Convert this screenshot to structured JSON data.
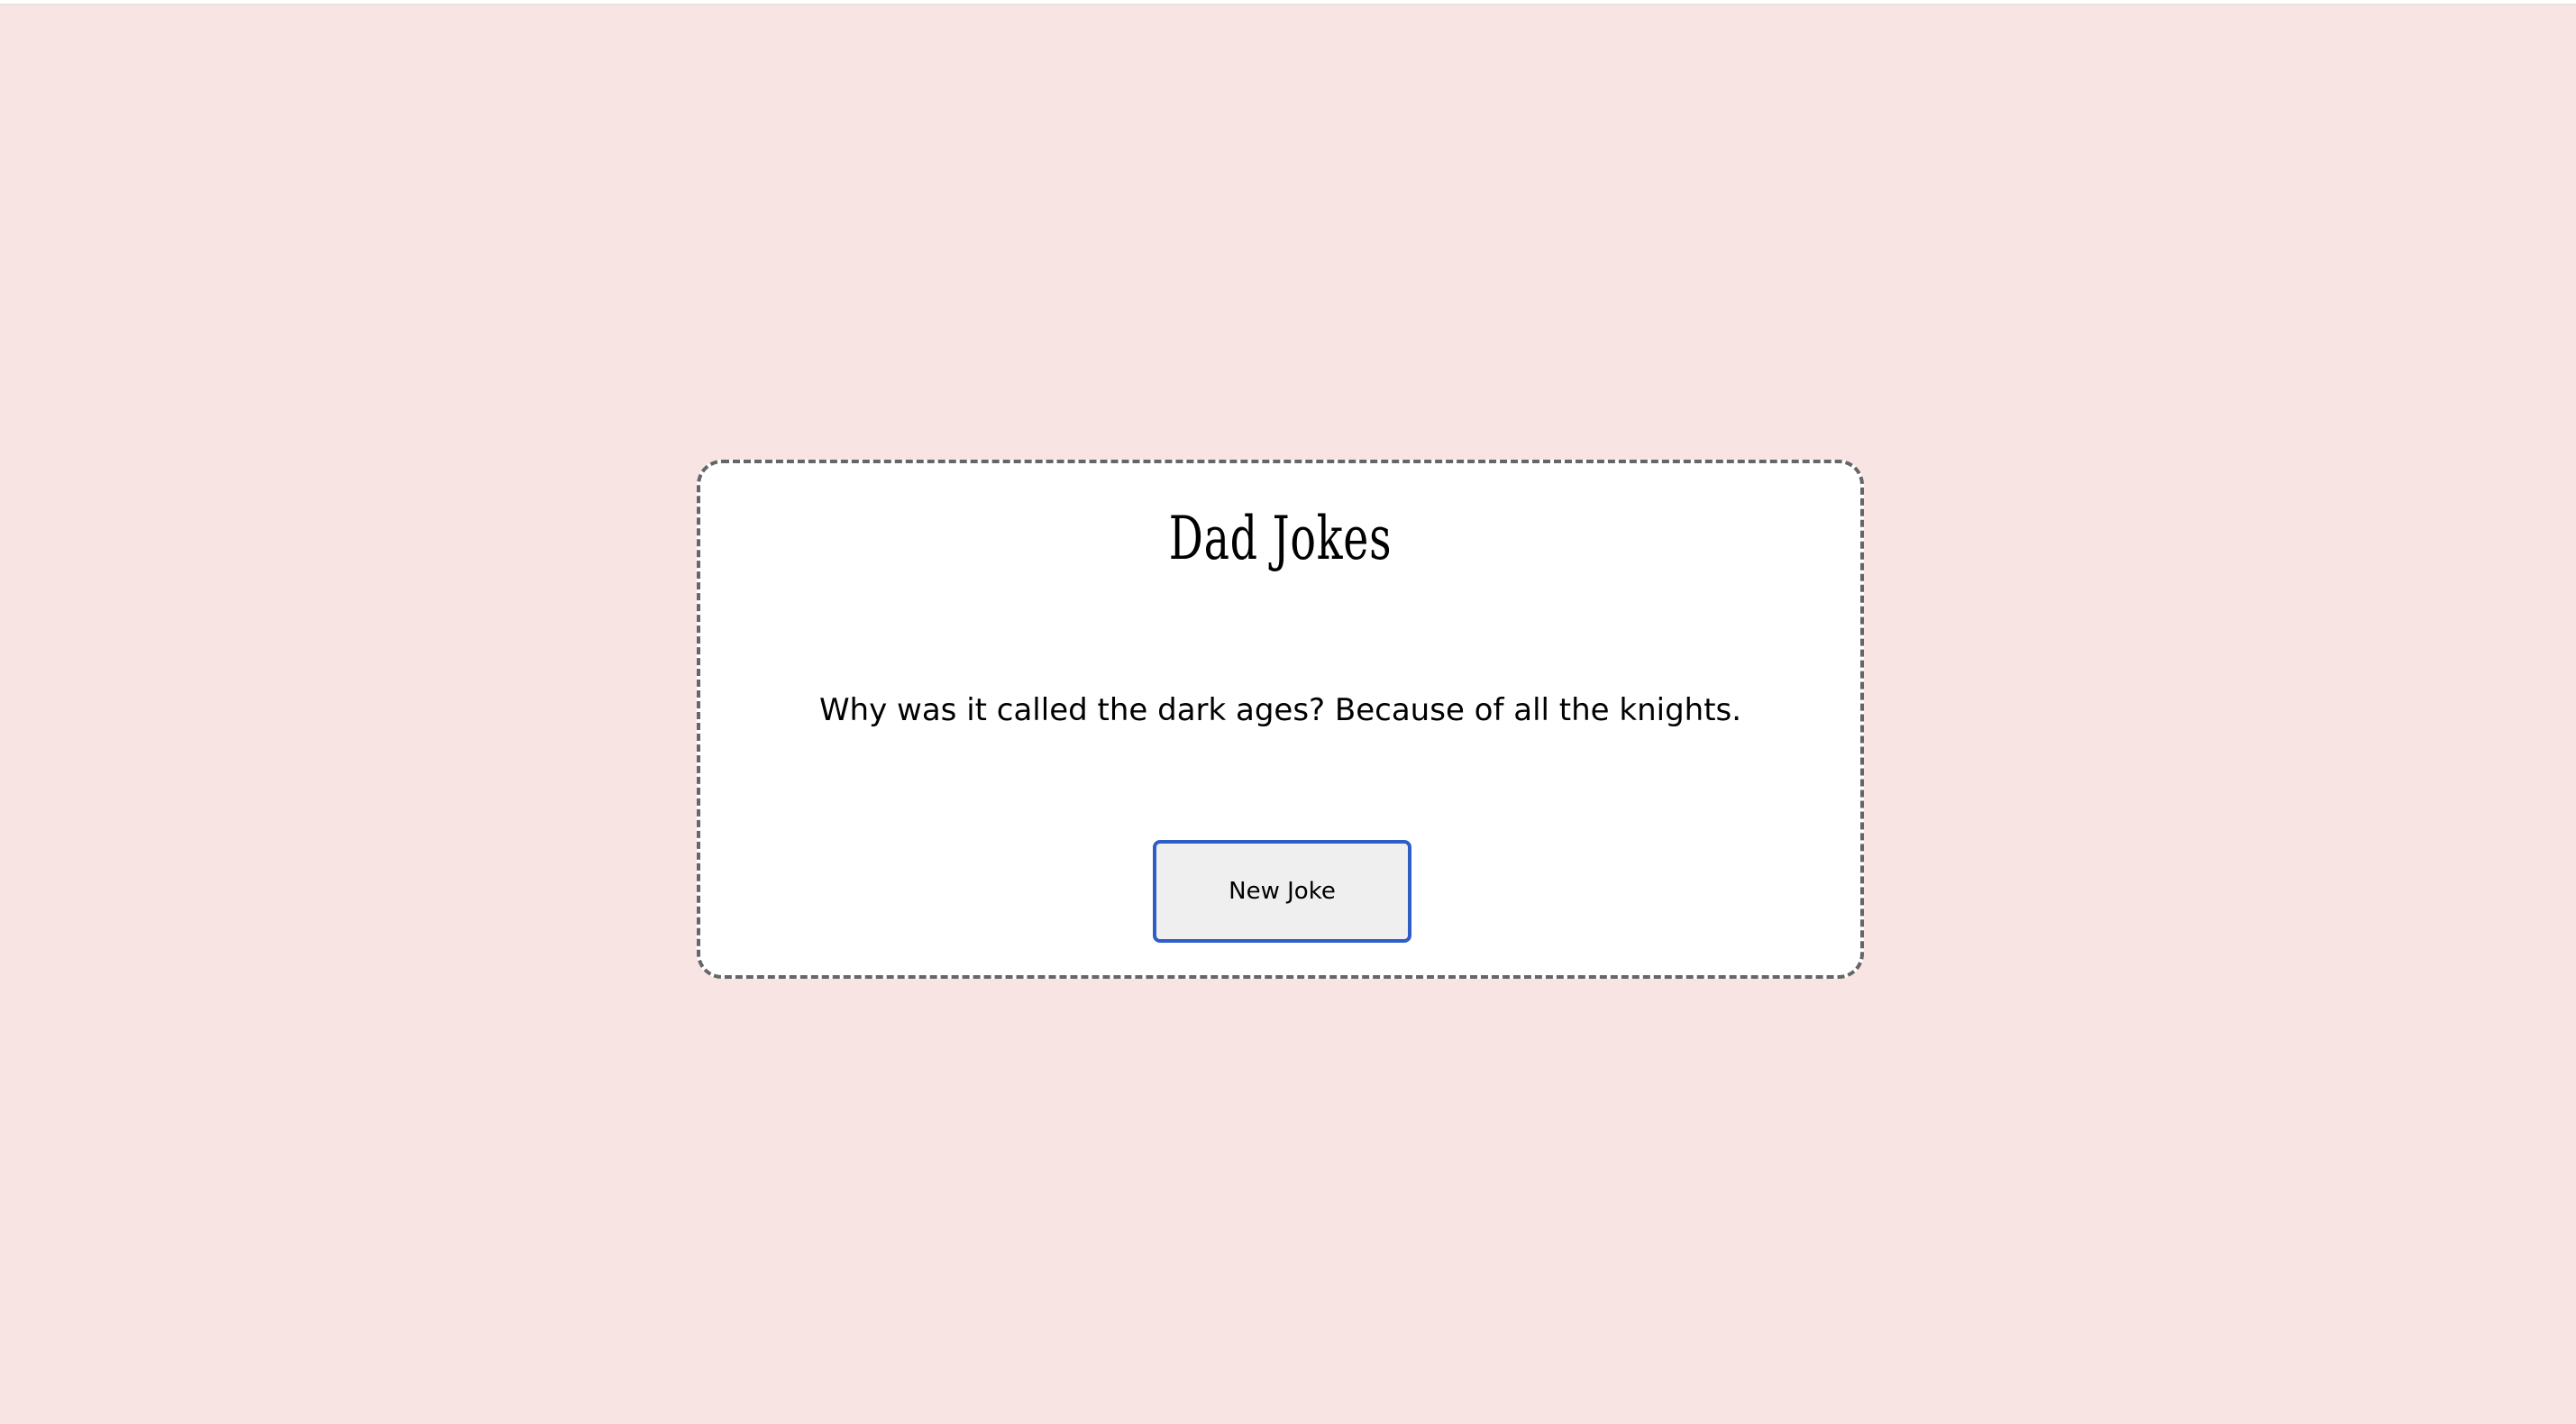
{
  "app": {
    "title": "Dad Jokes"
  },
  "joke": {
    "text": "Why was it called the dark ages? Because of all the knights."
  },
  "actions": {
    "new_joke_label": "New Joke"
  },
  "colors": {
    "background": "#f8e4e3",
    "card": "#ffffff",
    "card_border": "#666666",
    "button_background": "#efefef",
    "button_border": "#2d5ec6",
    "text": "#000000"
  }
}
